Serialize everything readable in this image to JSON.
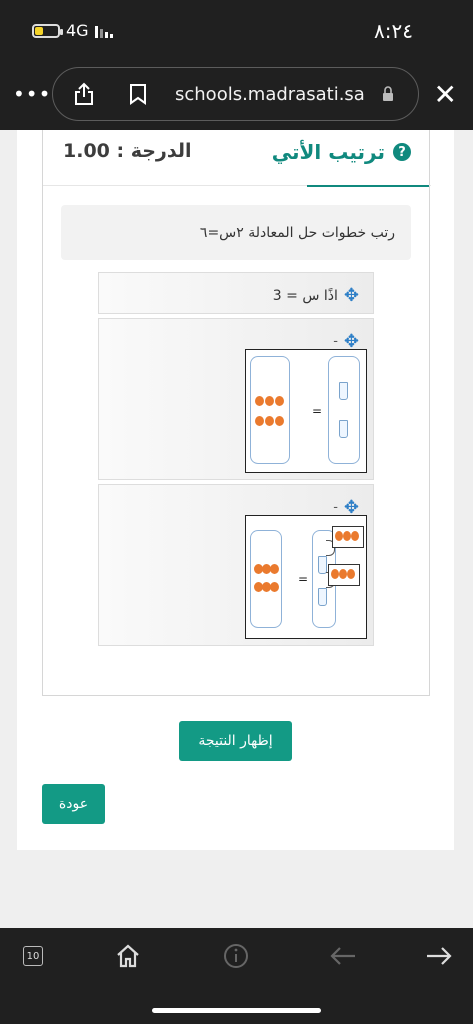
{
  "status": {
    "time": "٨:٢٤",
    "network": "4G"
  },
  "browser": {
    "url": "schools.madrasati.sa"
  },
  "card": {
    "title": "ترتيب الأتي",
    "grade": "الدرجة : 1.00",
    "question": "رتب خطوات حل المعادلة ٢س=٦",
    "items": [
      {
        "text": "اذًا س = 3"
      },
      {
        "text": "-"
      },
      {
        "text": "-"
      }
    ]
  },
  "buttons": {
    "show_result": "إظهار النتيجة",
    "back": "عودة"
  },
  "bottom": {
    "tabs_count": "10"
  },
  "colors": {
    "accent": "#139a85",
    "title": "#10897e",
    "move_icon": "#2e7fc7",
    "counter": "#ea7a2e"
  }
}
